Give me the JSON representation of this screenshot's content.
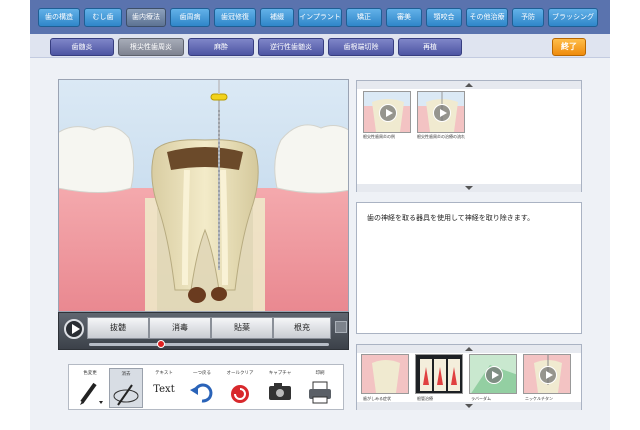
{
  "main_tabs": [
    {
      "label": "歯の構造"
    },
    {
      "label": "むし歯"
    },
    {
      "label": "歯内療法"
    },
    {
      "label": "歯周病"
    },
    {
      "label": "歯冠修復"
    },
    {
      "label": "補綴"
    },
    {
      "label": "インプラント"
    },
    {
      "label": "矯正"
    },
    {
      "label": "審美"
    },
    {
      "label": "顎咬合"
    },
    {
      "label": "その他治療"
    },
    {
      "label": "予防"
    },
    {
      "label": "ブラッシング"
    }
  ],
  "sub_tabs": [
    {
      "label": "歯髄炎"
    },
    {
      "label": "根尖性歯周炎"
    },
    {
      "label": "麻酔"
    },
    {
      "label": "逆行性歯髄炎"
    },
    {
      "label": "歯根端切除"
    },
    {
      "label": "再植"
    }
  ],
  "exit_label": "終了",
  "player": {
    "steps": [
      {
        "label": "抜髄"
      },
      {
        "label": "消毒"
      },
      {
        "label": "貼薬"
      },
      {
        "label": "根充"
      }
    ],
    "progress": 0.3
  },
  "top_thumbs": [
    {
      "label": "根尖性歯周炎の例"
    },
    {
      "label": "根尖性歯周炎の治療の流れ"
    }
  ],
  "description": "歯の神経を取る器具を使用して神経を取り除きます。",
  "bottom_thumbs": [
    {
      "label": "歯がしみる症状"
    },
    {
      "label": "根管治療"
    },
    {
      "label": "ラバーダム"
    },
    {
      "label": "ニッケルチタン"
    }
  ],
  "tools": [
    {
      "label": "色変更",
      "icon": "pen-icon"
    },
    {
      "label": "消去",
      "icon": "eraser-icon"
    },
    {
      "label": "テキスト",
      "icon": "text-icon",
      "glyph": "Text"
    },
    {
      "label": "一つ戻る",
      "icon": "undo-icon"
    },
    {
      "label": "オールクリア",
      "icon": "clear-all-icon"
    },
    {
      "label": "キャプチャ",
      "icon": "camera-icon"
    },
    {
      "label": "印刷",
      "icon": "printer-icon"
    }
  ],
  "colors": {
    "accent": "#2f86c9",
    "sub_tab": "#4d55a3",
    "exit": "#ef8b0d",
    "progress_knob": "#e02020"
  }
}
